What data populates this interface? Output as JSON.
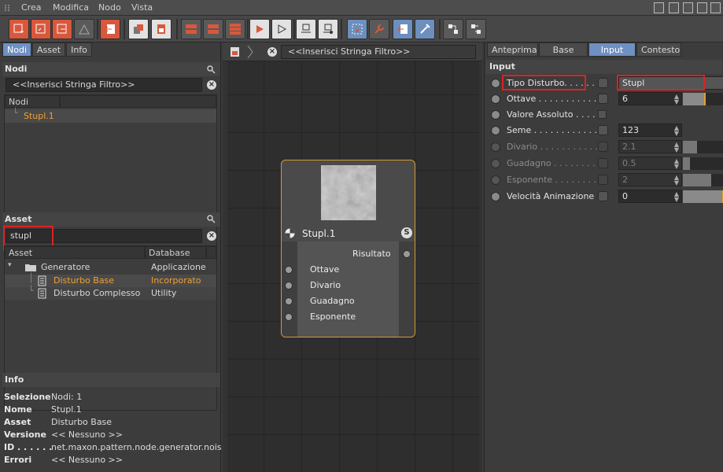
{
  "menu": {
    "items": [
      "Crea",
      "Modifica",
      "Nodo",
      "Vista"
    ]
  },
  "left": {
    "tabs": [
      "Nodi",
      "Asset",
      "Info"
    ],
    "nodes_header": "Nodi",
    "nodes_filter": "<<Inserisci Stringa Filtro>>",
    "nodes_column": "Nodi",
    "nodes_tree": [
      {
        "label": "Stupl.1"
      }
    ],
    "asset_header": "Asset",
    "asset_search": "stupl",
    "asset_columns": [
      "Asset",
      "Database"
    ],
    "asset_tree": [
      {
        "label": "Generatore",
        "db": "Applicazione"
      },
      {
        "label": "Disturbo Base",
        "db": "Incorporato"
      },
      {
        "label": "Disturbo Complesso",
        "db": "Utility"
      }
    ],
    "info_header": "Info",
    "info": [
      {
        "k": "Selezione",
        "v": "Nodi: 1"
      },
      {
        "k": "Nome . . .",
        "v": "Stupl.1"
      },
      {
        "k": "Asset . . .",
        "v": "Disturbo Base"
      },
      {
        "k": "Versione",
        "v": "<< Nessuno >>"
      },
      {
        "k": "ID . . . . . .",
        "v": "net.maxon.pattern.node.generator.noise("
      },
      {
        "k": "Errori",
        "v": "<< Nessuno >>"
      }
    ]
  },
  "editor": {
    "filter": "<<Inserisci Stringa Filtro>>",
    "node": {
      "title": "Stupl.1",
      "badge": "S",
      "output": "Risultato",
      "inputs": [
        "Ottave",
        "Divario",
        "Guadagno",
        "Esponente"
      ]
    }
  },
  "right": {
    "tabs": [
      "Anteprima",
      "Base",
      "Input",
      "Contesto"
    ],
    "active_tab": "Input",
    "section": "Input",
    "props": [
      {
        "name": "Tipo Disturbo. . . . . . . .",
        "value": "Stupl",
        "kind": "dropdown",
        "enabled": true
      },
      {
        "name": "Ottave . . . . . . . . . . . . .",
        "value": "6",
        "kind": "number",
        "enabled": true,
        "slider": 0.55
      },
      {
        "name": "Valore Assoluto . . . . .",
        "value": "",
        "kind": "checkbox",
        "enabled": true
      },
      {
        "name": "Seme . . . . . . . . . . . . . .",
        "value": "123",
        "kind": "number",
        "enabled": true
      },
      {
        "name": "Divario . . . . . . . . . . . .",
        "value": "2.1",
        "kind": "number",
        "enabled": false,
        "slider": 0.35
      },
      {
        "name": "Guadagno . . . . . . . . . .",
        "value": "0.5",
        "kind": "number",
        "enabled": false,
        "slider": 0.17
      },
      {
        "name": "Esponente . . . . . . . . .",
        "value": "2",
        "kind": "number",
        "enabled": false,
        "slider": 0.7
      },
      {
        "name": "Velocità Animazione",
        "value": "0",
        "kind": "number",
        "enabled": true,
        "slider": 1.0
      }
    ]
  },
  "colors": {
    "accent_blue": "#6f90c2",
    "node_border": "#d69a2d",
    "highlight": "#dd2222",
    "asset_selected": "#f0a030"
  }
}
